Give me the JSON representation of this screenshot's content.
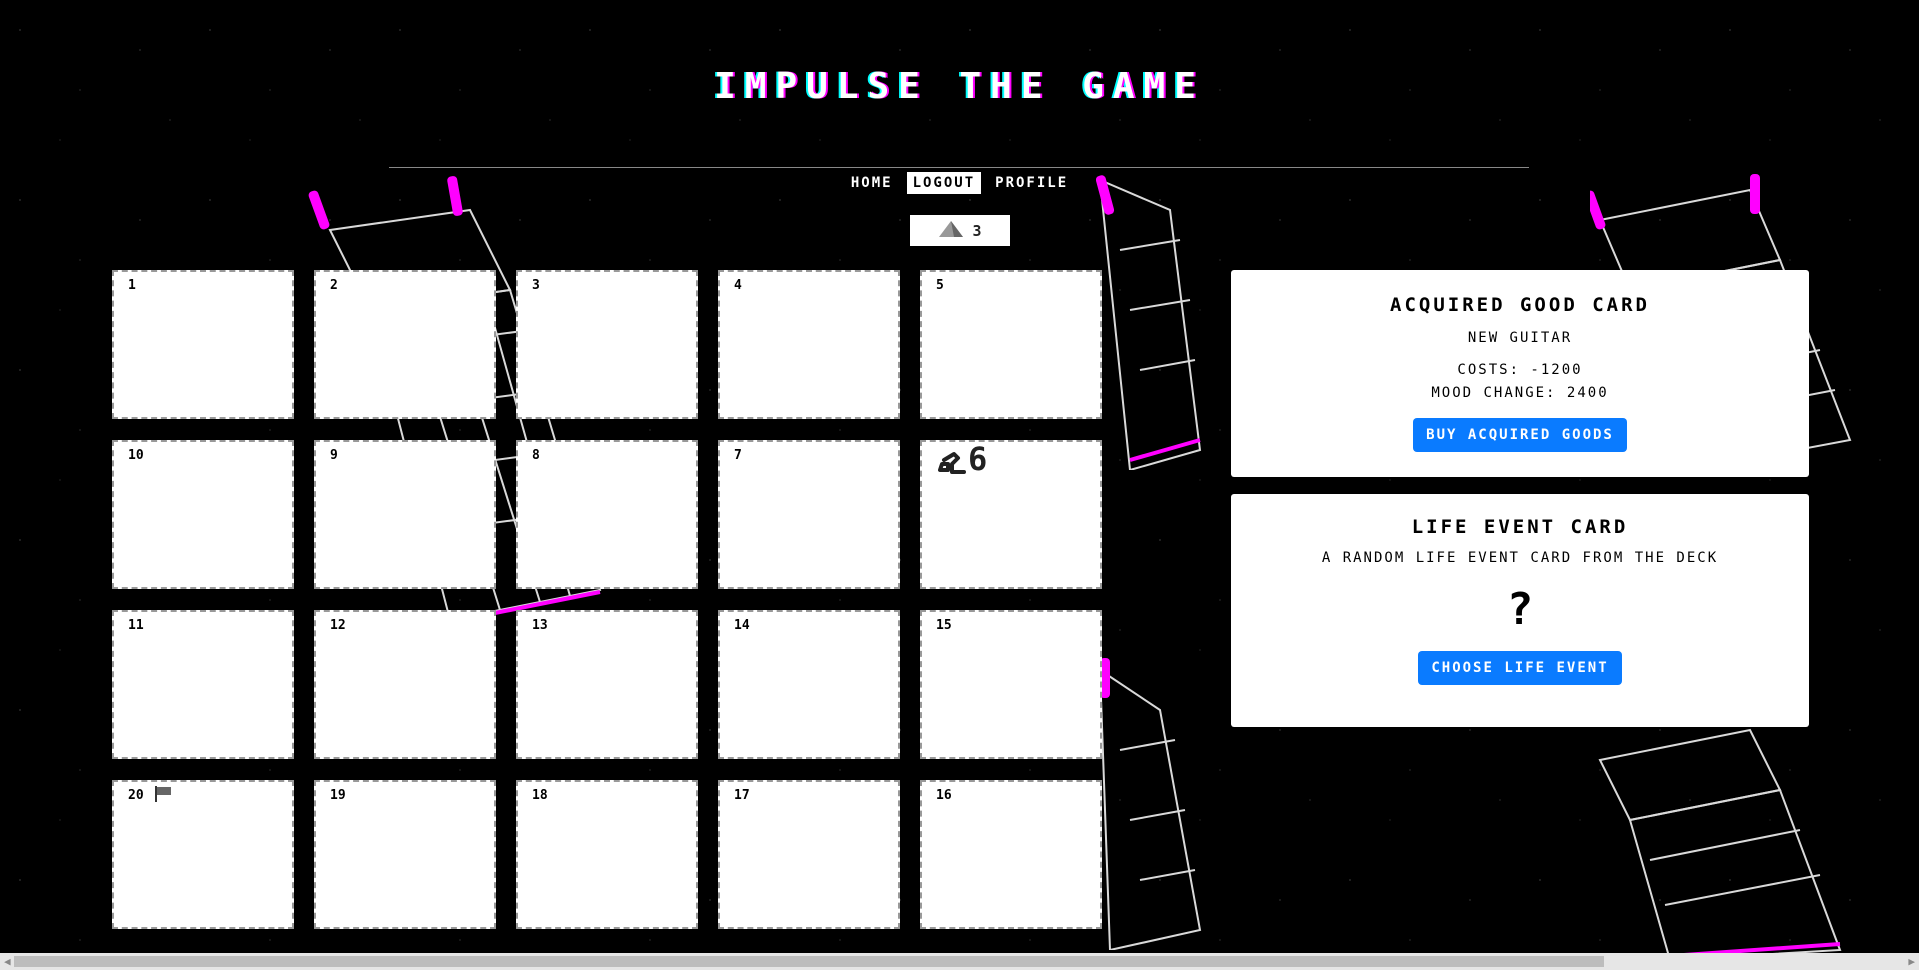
{
  "title": "IMPULSE THE GAME",
  "nav": [
    {
      "label": "HOME"
    },
    {
      "label": "LOGOUT",
      "active": true
    },
    {
      "label": "PROFILE"
    }
  ],
  "dice": {
    "icon": "pyramid-icon",
    "value": "3"
  },
  "board": {
    "rows": [
      [
        "1",
        "2",
        "3",
        "4",
        "5"
      ],
      [
        "10",
        "9",
        "8",
        "7",
        "6"
      ],
      [
        "11",
        "12",
        "13",
        "14",
        "15"
      ],
      [
        "20",
        "19",
        "18",
        "17",
        "16"
      ]
    ],
    "player_token": {
      "icon": "player-token-icon",
      "cell": "6",
      "label": "6"
    },
    "flag_cell": "20"
  },
  "acquired_card": {
    "title": "ACQUIRED GOOD CARD",
    "item": "NEW GUITAR",
    "costs": "COSTS: -1200",
    "mood": "MOOD CHANGE: 2400",
    "button": "BUY ACQUIRED GOODS"
  },
  "life_card": {
    "title": "LIFE EVENT CARD",
    "description": "A RANDOM LIFE EVENT CARD FROM THE DECK",
    "mystery": "?",
    "button": "CHOOSE LIFE EVENT"
  },
  "colors": {
    "accent": "#0a7bff",
    "glitch_magenta": "#ff00ff",
    "glitch_cyan": "#00ffff"
  }
}
